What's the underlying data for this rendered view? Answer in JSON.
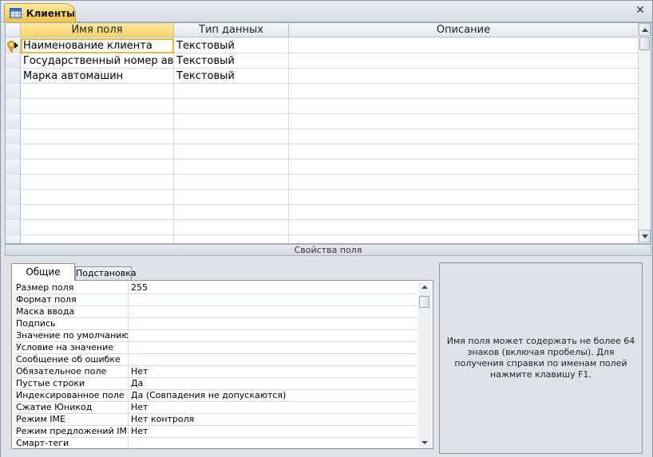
{
  "tab": {
    "title": "Клиенты",
    "close_glyph": "✕"
  },
  "grid": {
    "columns": [
      "Имя поля",
      "Тип данных",
      "Описание"
    ],
    "rows": [
      {
        "name": "Наименование клиента",
        "type": "Текстовый",
        "description": ""
      },
      {
        "name": "Государственный номер авто",
        "type": "Текстовый",
        "description": ""
      },
      {
        "name": "Марка автомашин",
        "type": "Текстовый",
        "description": ""
      }
    ]
  },
  "properties_bar": {
    "label": "Свойства поля"
  },
  "property_tabs": {
    "general": "Общие",
    "lookup": "Подстановка"
  },
  "properties": [
    {
      "name": "Размер поля",
      "value": "255"
    },
    {
      "name": "Формат поля",
      "value": ""
    },
    {
      "name": "Маска ввода",
      "value": ""
    },
    {
      "name": "Подпись",
      "value": ""
    },
    {
      "name": "Значение по умолчанию",
      "value": ""
    },
    {
      "name": "Условие на значение",
      "value": ""
    },
    {
      "name": "Сообщение об ошибке",
      "value": ""
    },
    {
      "name": "Обязательное поле",
      "value": "Нет"
    },
    {
      "name": "Пустые строки",
      "value": "Да"
    },
    {
      "name": "Индексированное поле",
      "value": "Да (Совпадения не допускаются)"
    },
    {
      "name": "Сжатие Юникод",
      "value": "Нет"
    },
    {
      "name": "Режим IME",
      "value": "Нет контроля"
    },
    {
      "name": "Режим предложений IME",
      "value": "Нет"
    },
    {
      "name": "Смарт-теги",
      "value": ""
    }
  ],
  "help": {
    "text": "Имя поля может содержать не более 64 знаков (включая пробелы). Для получения справки по именам полей нажмите клавишу F1."
  },
  "icons": {
    "tab": "table-icon",
    "close": "close-icon",
    "key": "primary-key-icon",
    "row_pointer": "current-row-arrow-icon"
  }
}
